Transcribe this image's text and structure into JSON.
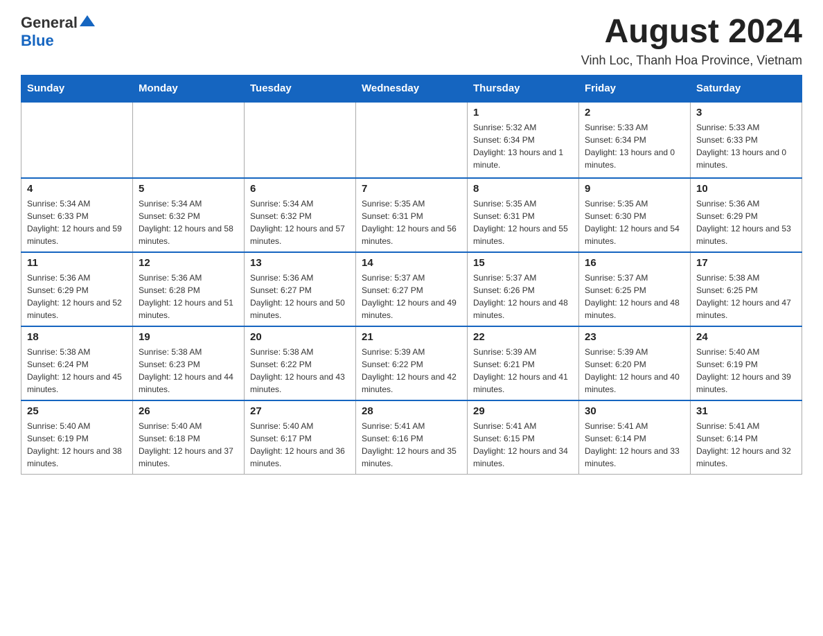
{
  "header": {
    "logo_general": "General",
    "logo_blue": "Blue",
    "month_year": "August 2024",
    "location": "Vinh Loc, Thanh Hoa Province, Vietnam"
  },
  "days_of_week": [
    "Sunday",
    "Monday",
    "Tuesday",
    "Wednesday",
    "Thursday",
    "Friday",
    "Saturday"
  ],
  "weeks": [
    [
      {
        "day": "",
        "info": ""
      },
      {
        "day": "",
        "info": ""
      },
      {
        "day": "",
        "info": ""
      },
      {
        "day": "",
        "info": ""
      },
      {
        "day": "1",
        "info": "Sunrise: 5:32 AM\nSunset: 6:34 PM\nDaylight: 13 hours and 1 minute."
      },
      {
        "day": "2",
        "info": "Sunrise: 5:33 AM\nSunset: 6:34 PM\nDaylight: 13 hours and 0 minutes."
      },
      {
        "day": "3",
        "info": "Sunrise: 5:33 AM\nSunset: 6:33 PM\nDaylight: 13 hours and 0 minutes."
      }
    ],
    [
      {
        "day": "4",
        "info": "Sunrise: 5:34 AM\nSunset: 6:33 PM\nDaylight: 12 hours and 59 minutes."
      },
      {
        "day": "5",
        "info": "Sunrise: 5:34 AM\nSunset: 6:32 PM\nDaylight: 12 hours and 58 minutes."
      },
      {
        "day": "6",
        "info": "Sunrise: 5:34 AM\nSunset: 6:32 PM\nDaylight: 12 hours and 57 minutes."
      },
      {
        "day": "7",
        "info": "Sunrise: 5:35 AM\nSunset: 6:31 PM\nDaylight: 12 hours and 56 minutes."
      },
      {
        "day": "8",
        "info": "Sunrise: 5:35 AM\nSunset: 6:31 PM\nDaylight: 12 hours and 55 minutes."
      },
      {
        "day": "9",
        "info": "Sunrise: 5:35 AM\nSunset: 6:30 PM\nDaylight: 12 hours and 54 minutes."
      },
      {
        "day": "10",
        "info": "Sunrise: 5:36 AM\nSunset: 6:29 PM\nDaylight: 12 hours and 53 minutes."
      }
    ],
    [
      {
        "day": "11",
        "info": "Sunrise: 5:36 AM\nSunset: 6:29 PM\nDaylight: 12 hours and 52 minutes."
      },
      {
        "day": "12",
        "info": "Sunrise: 5:36 AM\nSunset: 6:28 PM\nDaylight: 12 hours and 51 minutes."
      },
      {
        "day": "13",
        "info": "Sunrise: 5:36 AM\nSunset: 6:27 PM\nDaylight: 12 hours and 50 minutes."
      },
      {
        "day": "14",
        "info": "Sunrise: 5:37 AM\nSunset: 6:27 PM\nDaylight: 12 hours and 49 minutes."
      },
      {
        "day": "15",
        "info": "Sunrise: 5:37 AM\nSunset: 6:26 PM\nDaylight: 12 hours and 48 minutes."
      },
      {
        "day": "16",
        "info": "Sunrise: 5:37 AM\nSunset: 6:25 PM\nDaylight: 12 hours and 48 minutes."
      },
      {
        "day": "17",
        "info": "Sunrise: 5:38 AM\nSunset: 6:25 PM\nDaylight: 12 hours and 47 minutes."
      }
    ],
    [
      {
        "day": "18",
        "info": "Sunrise: 5:38 AM\nSunset: 6:24 PM\nDaylight: 12 hours and 45 minutes."
      },
      {
        "day": "19",
        "info": "Sunrise: 5:38 AM\nSunset: 6:23 PM\nDaylight: 12 hours and 44 minutes."
      },
      {
        "day": "20",
        "info": "Sunrise: 5:38 AM\nSunset: 6:22 PM\nDaylight: 12 hours and 43 minutes."
      },
      {
        "day": "21",
        "info": "Sunrise: 5:39 AM\nSunset: 6:22 PM\nDaylight: 12 hours and 42 minutes."
      },
      {
        "day": "22",
        "info": "Sunrise: 5:39 AM\nSunset: 6:21 PM\nDaylight: 12 hours and 41 minutes."
      },
      {
        "day": "23",
        "info": "Sunrise: 5:39 AM\nSunset: 6:20 PM\nDaylight: 12 hours and 40 minutes."
      },
      {
        "day": "24",
        "info": "Sunrise: 5:40 AM\nSunset: 6:19 PM\nDaylight: 12 hours and 39 minutes."
      }
    ],
    [
      {
        "day": "25",
        "info": "Sunrise: 5:40 AM\nSunset: 6:19 PM\nDaylight: 12 hours and 38 minutes."
      },
      {
        "day": "26",
        "info": "Sunrise: 5:40 AM\nSunset: 6:18 PM\nDaylight: 12 hours and 37 minutes."
      },
      {
        "day": "27",
        "info": "Sunrise: 5:40 AM\nSunset: 6:17 PM\nDaylight: 12 hours and 36 minutes."
      },
      {
        "day": "28",
        "info": "Sunrise: 5:41 AM\nSunset: 6:16 PM\nDaylight: 12 hours and 35 minutes."
      },
      {
        "day": "29",
        "info": "Sunrise: 5:41 AM\nSunset: 6:15 PM\nDaylight: 12 hours and 34 minutes."
      },
      {
        "day": "30",
        "info": "Sunrise: 5:41 AM\nSunset: 6:14 PM\nDaylight: 12 hours and 33 minutes."
      },
      {
        "day": "31",
        "info": "Sunrise: 5:41 AM\nSunset: 6:14 PM\nDaylight: 12 hours and 32 minutes."
      }
    ]
  ]
}
